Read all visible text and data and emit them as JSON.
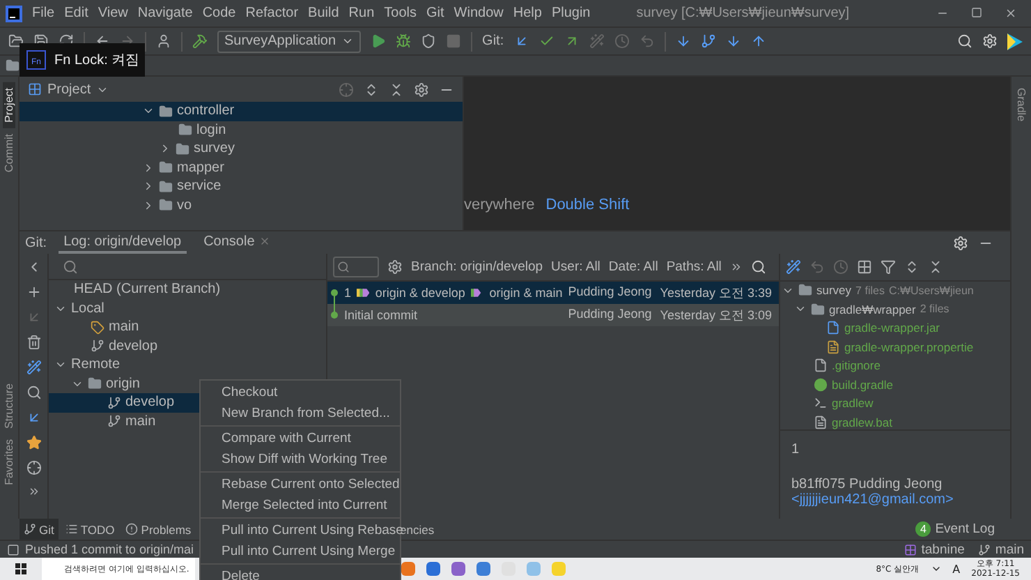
{
  "menu_bar": {
    "items": [
      "File",
      "Edit",
      "View",
      "Navigate",
      "Code",
      "Refactor",
      "Build",
      "Run",
      "Tools",
      "Git",
      "Window",
      "Help",
      "Plugin"
    ],
    "title": "survey [C:₩Users₩jieun₩survey]"
  },
  "toolbar": {
    "run_config": "SurveyApplication",
    "git_label": "Git:"
  },
  "fn_lock_tooltip": {
    "badge": "Fn",
    "text": "Fn  Lock: 켜짐"
  },
  "left_strip": [
    {
      "label": "Project",
      "selected": true
    },
    {
      "label": "Commit",
      "selected": false
    },
    {
      "label": "Structure",
      "selected": false
    },
    {
      "label": "Favorites",
      "selected": false
    }
  ],
  "right_strip": {
    "label": "Gradle"
  },
  "project_panel": {
    "title": "Project",
    "tree": [
      {
        "label": "controller",
        "expanded": true,
        "selected": true,
        "children": [
          {
            "label": "login",
            "selected": false
          },
          {
            "label": "survey",
            "expanded": false,
            "selected": false
          }
        ]
      },
      {
        "label": "mapper",
        "expanded": false,
        "selected": false
      },
      {
        "label": "service",
        "expanded": false,
        "selected": false
      },
      {
        "label": "vo",
        "expanded": false,
        "selected": false
      }
    ]
  },
  "editor": {
    "hint": "verywhere",
    "shortcut": "Double Shift"
  },
  "git_window": {
    "label": "Git:",
    "tabs": [
      {
        "label": "Log: origin/develop",
        "selected": true,
        "closable": false
      },
      {
        "label": "Console",
        "selected": false,
        "closable": true
      }
    ]
  },
  "branches": [
    {
      "label": "HEAD (Current Branch)",
      "selected": false
    },
    {
      "label": "Local",
      "expanded": true,
      "selected": false,
      "children": [
        {
          "label": "main",
          "kind": "tag",
          "selected": false
        },
        {
          "label": "develop",
          "kind": "branch",
          "selected": false
        }
      ]
    },
    {
      "label": "Remote",
      "expanded": true,
      "selected": false,
      "children": [
        {
          "label": "origin",
          "kind": "folder",
          "expanded": true,
          "selected": false,
          "children": [
            {
              "label": "develop",
              "kind": "branch",
              "selected": true
            },
            {
              "label": "main",
              "kind": "branch",
              "selected": false
            }
          ]
        }
      ]
    }
  ],
  "log": {
    "filters": [
      "Branch: origin/develop",
      "User: All",
      "Date: All",
      "Paths: All"
    ],
    "commits": [
      {
        "message": "1",
        "refs": [
          "origin & develop",
          "origin & main"
        ],
        "author": "Pudding Jeong",
        "date": "Yesterday 오전 3:39",
        "selected": true
      },
      {
        "message": "Initial commit",
        "author": "Pudding Jeong",
        "date": "Yesterday 오전 3:09",
        "selected": false
      }
    ]
  },
  "changes": {
    "tree": [
      {
        "label": "survey",
        "kind": "module",
        "count": "7 files",
        "path": "C:₩Users₩jieun",
        "expanded": true,
        "children": [
          {
            "label": "gradle₩wrapper",
            "kind": "folder",
            "count": "2 files",
            "expanded": true,
            "children": [
              {
                "label": "gradle-wrapper.jar",
                "kind": "jar"
              },
              {
                "label": "gradle-wrapper.propertie",
                "kind": "properties"
              }
            ]
          },
          {
            "label": ".gitignore",
            "kind": "ignore"
          },
          {
            "label": "build.gradle",
            "kind": "gradle"
          },
          {
            "label": "gradlew",
            "kind": "script"
          },
          {
            "label": "gradlew.bat",
            "kind": "text"
          }
        ]
      }
    ],
    "details": {
      "message": "1",
      "hash_author": "b81ff075 Pudding Jeong",
      "email": "<jjjjjjieun421@gmail.com>"
    }
  },
  "bottom_tabs": [
    {
      "label": "Git",
      "kind": "git",
      "selected": true
    },
    {
      "label": "TODO",
      "kind": "todo",
      "selected": false
    },
    {
      "label": "Problems",
      "kind": "problems",
      "selected": false
    },
    {
      "label": "encies",
      "kind": "plain",
      "selected": false
    }
  ],
  "event_log": {
    "count": "4",
    "label": "Event Log"
  },
  "status_bar": {
    "message": "Pushed 1 commit to origin/mai",
    "plugin": "tabnine",
    "branch": "main"
  },
  "context_menu": [
    [
      "Checkout",
      "New Branch from Selected..."
    ],
    [
      "Compare with Current",
      "Show Diff with Working Tree"
    ],
    [
      "Rebase Current onto Selected",
      "Merge Selected into Current"
    ],
    [
      "Pull into Current Using Rebase",
      "Pull into Current Using Merge"
    ],
    [
      "Delete"
    ]
  ],
  "taskbar": {
    "search_placeholder": "검색하려면 여기에 입력하십시오.",
    "weather": "8°C 실안개",
    "ime": "A",
    "time": "오후 7:11",
    "date": "2021-12-15"
  }
}
